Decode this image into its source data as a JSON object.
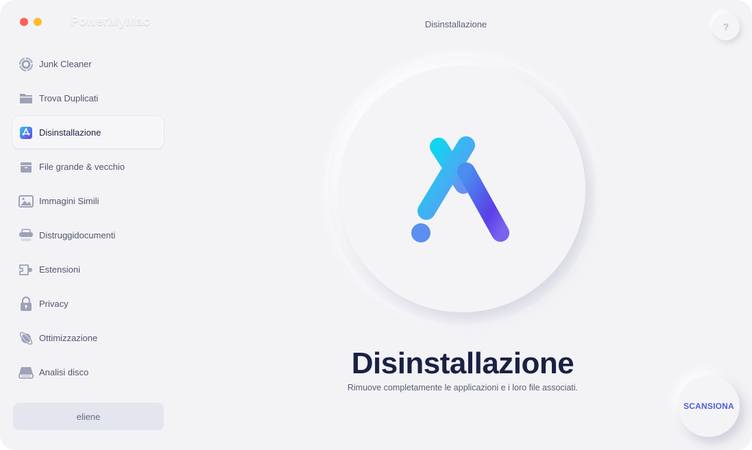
{
  "window": {
    "app_name": "PowerMyMac",
    "traffic_lights": [
      "close",
      "minimize"
    ]
  },
  "header": {
    "title": "Disinstallazione",
    "help_label": "?"
  },
  "sidebar": {
    "items": [
      {
        "label": "Junk Cleaner",
        "icon": "junk-cleaner-icon",
        "active": false
      },
      {
        "label": "Trova Duplicati",
        "icon": "folder-icon",
        "active": false
      },
      {
        "label": "Disinstallazione",
        "icon": "app-store-icon",
        "active": true
      },
      {
        "label": "File grande & vecchio",
        "icon": "archive-box-icon",
        "active": false
      },
      {
        "label": "Immagini Simili",
        "icon": "image-icon",
        "active": false
      },
      {
        "label": "Distruggidocumenti",
        "icon": "shredder-icon",
        "active": false
      },
      {
        "label": "Estensioni",
        "icon": "plugin-icon",
        "active": false
      },
      {
        "label": "Privacy",
        "icon": "lock-icon",
        "active": false
      },
      {
        "label": "Ottimizzazione",
        "icon": "planet-icon",
        "active": false
      },
      {
        "label": "Analisi disco",
        "icon": "disk-icon",
        "active": false
      }
    ],
    "user": "eliene"
  },
  "main": {
    "title": "Disinstallazione",
    "subtitle": "Rimuove completamente le applicazioni e i loro file associati.",
    "scan_button": "SCANSIONA"
  },
  "colors": {
    "background": "#f3f3f6",
    "title_text": "#1b2143",
    "accent": "#4d5fd8",
    "icon_gray": "#9ea2b8"
  }
}
